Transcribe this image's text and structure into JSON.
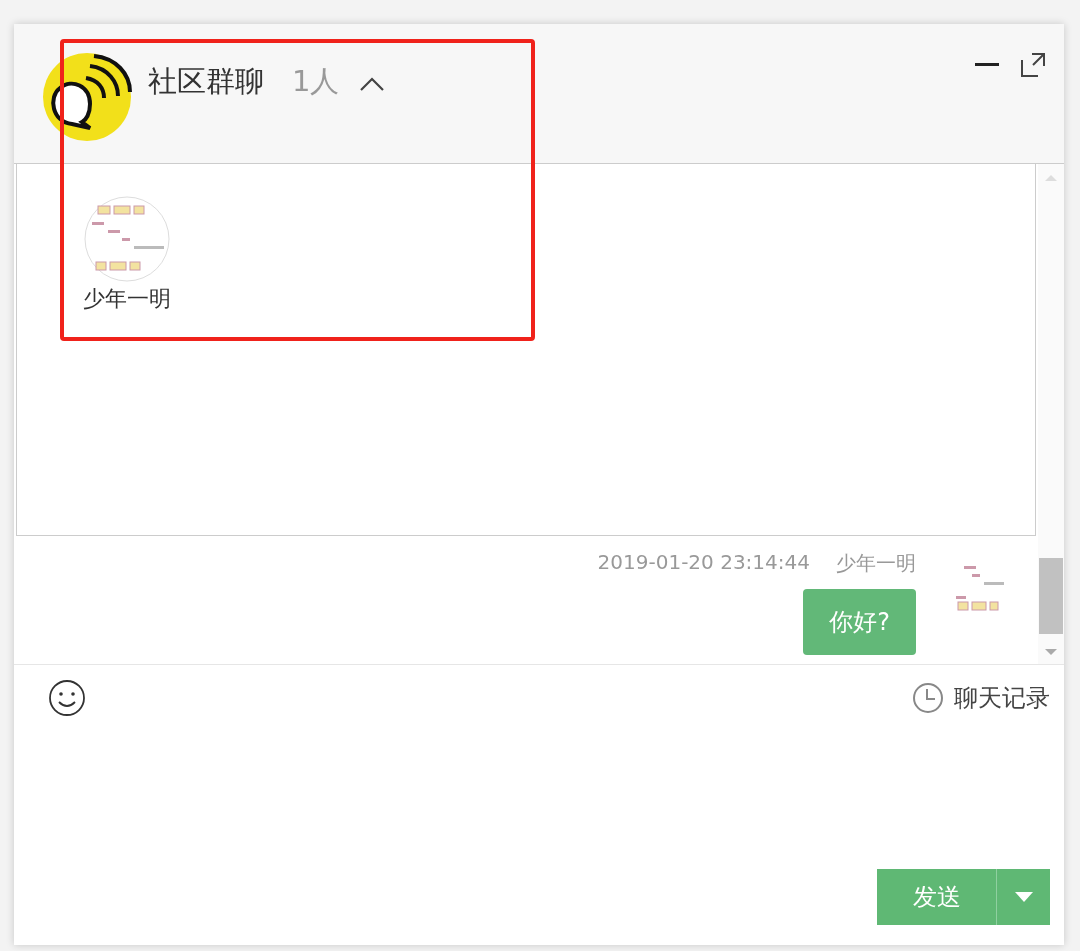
{
  "window": {
    "title": "社区群聊",
    "member_count": "1人",
    "members_expanded": true
  },
  "members": [
    {
      "name": "少年一明"
    }
  ],
  "messages": [
    {
      "kind": "outgoing",
      "sender": "少年一明",
      "time": "2019-01-20 23:14:44",
      "text": "你好?"
    }
  ],
  "toolbar": {
    "history_label": "聊天记录"
  },
  "send_button": {
    "label": "发送"
  }
}
